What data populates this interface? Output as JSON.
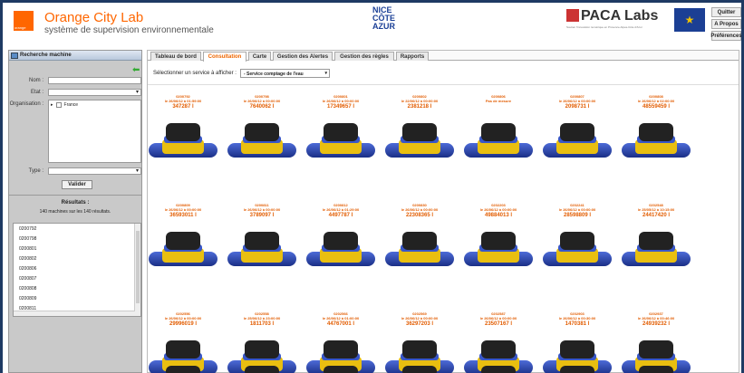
{
  "header": {
    "orange_logo": "orange",
    "title": "Orange City Lab",
    "subtitle": "système de supervision environnementale",
    "nca_logo": [
      "NICE",
      "CÔTE",
      "AZUR"
    ],
    "paca": {
      "name": "PACA Labs",
      "tag": "Soutien l'innovation numérique en Provence-Alpes-Côte d'Azur"
    },
    "buttons": {
      "quit": "Quitter",
      "about": "A Propos",
      "prefs": "Préférences"
    }
  },
  "sidebar": {
    "title": "Recherche machine",
    "labels": {
      "nom": "Nom :",
      "etat": "Etat :",
      "organisation": "Organisation :",
      "type": "Type :"
    },
    "org_tree": [
      {
        "label": "France"
      }
    ],
    "valider": "Valider",
    "results_title": "Résultats :",
    "results_count": "140 machines sur les 140 résultats.",
    "results": [
      "0200792",
      "0200798",
      "0200801",
      "0200802",
      "0200806",
      "0200807",
      "0200808",
      "0200809",
      "0200811"
    ]
  },
  "tabs": [
    "Tableau de bord",
    "Consultation",
    "Carte",
    "Gestion des Alertes",
    "Gestion des règles",
    "Rapports"
  ],
  "active_tab": "Consultation",
  "service": {
    "label": "Sélectionner un service à afficher :",
    "value": "- Service comptage de l'eau"
  },
  "meters": [
    {
      "id": "0200792",
      "date": "le 26/06/12 à 01:59:00",
      "value": "347287 l"
    },
    {
      "id": "0200798",
      "date": "le 26/06/12 à 00:00:00",
      "value": "7640062 l"
    },
    {
      "id": "0200801",
      "date": "le 26/06/12 à 00:00:00",
      "value": "17349657 l"
    },
    {
      "id": "0200802",
      "date": "le 22/06/12 à 00:00:00",
      "value": "2381218 l"
    },
    {
      "id": "0200806",
      "date": "Pas de mesure",
      "value": ""
    },
    {
      "id": "0200807",
      "date": "le 26/06/12 à 00:00:00",
      "value": "2098731 l"
    },
    {
      "id": "0200808",
      "date": "le 26/06/12 à 02:00:00",
      "value": "48559459 l"
    },
    {
      "id": "0200809",
      "date": "le 26/06/12 à 00:00:00",
      "value": "36593011 l"
    },
    {
      "id": "0200811",
      "date": "le 26/06/12 à 00:00:00",
      "value": "3789097 l"
    },
    {
      "id": "0200812",
      "date": "le 26/06/12 à 01:29:00",
      "value": "4497787 l"
    },
    {
      "id": "0200830",
      "date": "le 26/06/12 à 00:00:00",
      "value": "22308365 l"
    },
    {
      "id": "0202203",
      "date": "le 26/06/12 à 00:00:00",
      "value": "49884013 l"
    },
    {
      "id": "0202241",
      "date": "le 26/06/12 à 00:00:00",
      "value": "28598809 l"
    },
    {
      "id": "0202548",
      "date": "le 25/05/12 à 10:15:00",
      "value": "24417420 l"
    },
    {
      "id": "0202556",
      "date": "le 26/06/12 à 00:00:00",
      "value": "29996019 l"
    },
    {
      "id": "0202558",
      "date": "le 25/06/12 à 23:00:00",
      "value": "1811703 l"
    },
    {
      "id": "0202566",
      "date": "le 26/06/12 à 01:00:00",
      "value": "44767001 l"
    },
    {
      "id": "0202569",
      "date": "le 26/06/12 à 00:00:00",
      "value": "36297203 l"
    },
    {
      "id": "0202587",
      "date": "le 26/06/12 à 00:00:00",
      "value": "23507167 l"
    },
    {
      "id": "0202903",
      "date": "le 26/06/12 à 00:30:00",
      "value": "1470381 l"
    },
    {
      "id": "0202937",
      "date": "le 26/06/12 à 00:46:00",
      "value": "24939232 l"
    }
  ]
}
